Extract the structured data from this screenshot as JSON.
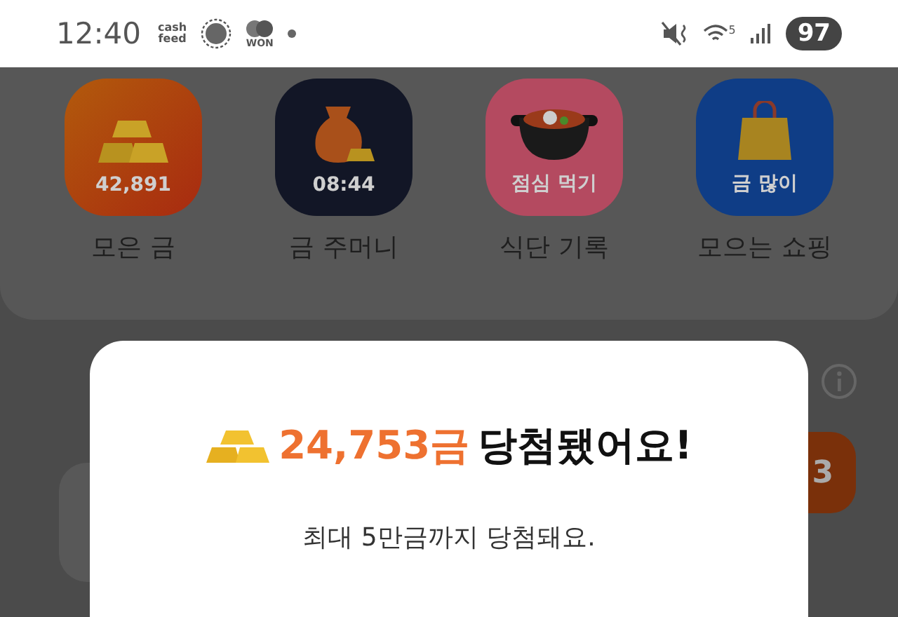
{
  "status_bar": {
    "time": "12:40",
    "cashfeed_logo": [
      "cash",
      "feed"
    ],
    "won_label": "WON",
    "wifi_label": "5",
    "battery": "97"
  },
  "tiles": [
    {
      "kind": "gold",
      "badge": "42,891",
      "label": "모은 금"
    },
    {
      "kind": "pouch",
      "badge": "08:44",
      "label": "금 주머니"
    },
    {
      "kind": "meal",
      "badge": "점심 먹기",
      "label": "식단 기록"
    },
    {
      "kind": "shopping",
      "badge": "금 많이",
      "label": "모으는 쇼핑"
    }
  ],
  "background": {
    "side_button_text": "3"
  },
  "modal": {
    "amount": "24,753금",
    "title": "당첨됐어요!",
    "subtitle": "최대 5만금까지 당첨돼요."
  }
}
